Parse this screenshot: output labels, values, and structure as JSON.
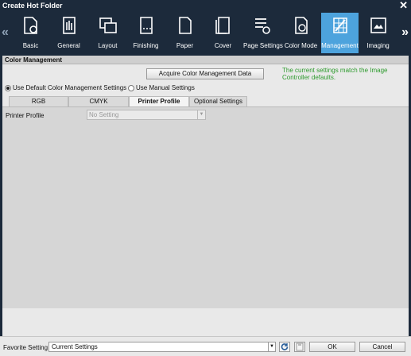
{
  "window": {
    "title": "Create Hot Folder",
    "close_glyph": "✕"
  },
  "toolbar": {
    "prev_glyph": "«",
    "next_glyph": "»",
    "buttons": [
      {
        "label": "Basic",
        "icon": "basic-icon"
      },
      {
        "label": "General",
        "icon": "general-icon"
      },
      {
        "label": "Layout",
        "icon": "layout-icon"
      },
      {
        "label": "Finishing",
        "icon": "finishing-icon"
      },
      {
        "label": "Paper",
        "icon": "paper-icon"
      },
      {
        "label": "Cover",
        "icon": "cover-icon"
      },
      {
        "label": "Page Settings",
        "icon": "page-settings-icon"
      },
      {
        "label": "Color Mode",
        "icon": "color-mode-icon"
      },
      {
        "label": "Management",
        "icon": "management-icon",
        "active": true
      },
      {
        "label": "Imaging",
        "icon": "imaging-icon"
      }
    ]
  },
  "section": {
    "title": "Color Management",
    "acquire_button": "Acquire Color Management Data",
    "note": "The current settings match the Image Controller defaults.",
    "radio_default": "Use Default Color Management Settings",
    "radio_manual": "Use Manual Settings",
    "tabs": [
      "RGB",
      "CMYK",
      "Printer Profile",
      "Optional Settings"
    ],
    "active_tab": "Printer Profile",
    "printer_profile_label": "Printer Profile",
    "printer_profile_value": "No Setting"
  },
  "footer": {
    "favorite_label": "Favorite Setting",
    "favorite_value": "Current Settings",
    "ok": "OK",
    "cancel": "Cancel"
  },
  "colors": {
    "accent": "#4da3dd",
    "titlebar": "#1c2a3b",
    "note_green": "#2c9a2c"
  }
}
